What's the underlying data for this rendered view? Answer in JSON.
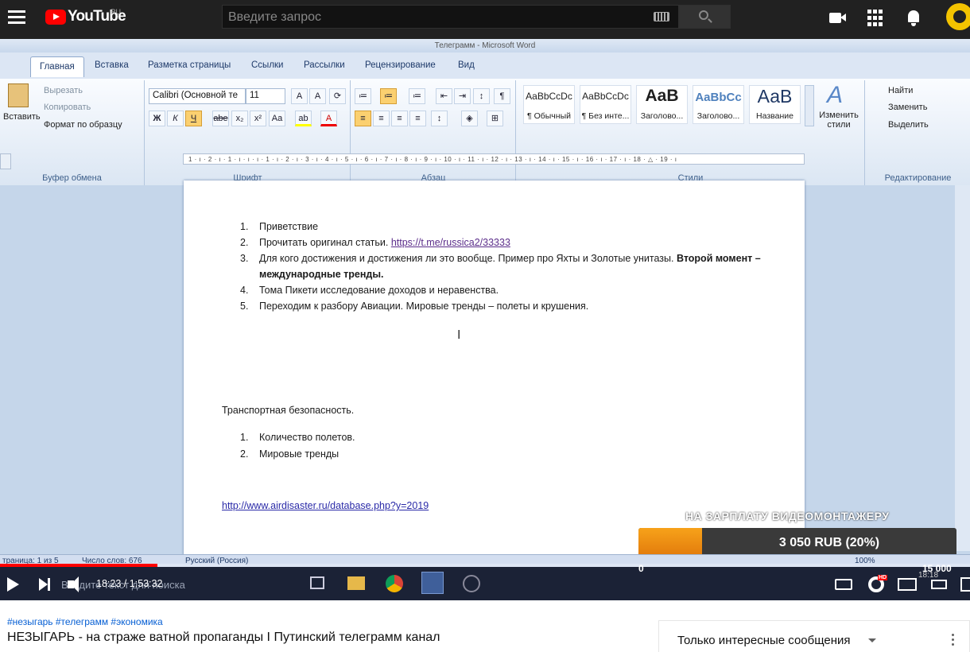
{
  "header": {
    "logo_text": "YouTube",
    "region": "RU",
    "search_placeholder": "Введите запрос"
  },
  "word": {
    "window_title": "Телеграмм - Microsoft Word",
    "tabs": [
      "Главная",
      "Вставка",
      "Разметка страницы",
      "Ссылки",
      "Рассылки",
      "Рецензирование",
      "Вид"
    ],
    "clipboard": {
      "paste": "Вставить",
      "cut": "Вырезать",
      "copy": "Копировать",
      "format_painter": "Формат по образцу",
      "label": "Буфер обмена"
    },
    "font": {
      "name": "Calibri (Основной те",
      "size": "11",
      "label": "Шрифт"
    },
    "paragraph": {
      "label": "Абзац"
    },
    "styles": {
      "tiles": [
        {
          "sample": "AaBbCcDc",
          "name": "¶ Обычный"
        },
        {
          "sample": "AaBbCcDc",
          "name": "¶ Без инте..."
        },
        {
          "sample": "AaB",
          "name": "Заголово..."
        },
        {
          "sample": "AaBbCc",
          "name": "Заголово..."
        },
        {
          "sample": "АаВ",
          "name": "Название"
        }
      ],
      "change": "Изменить стили",
      "label": "Стили"
    },
    "editing": {
      "find": "Найти",
      "replace": "Заменить",
      "select": "Выделить",
      "label": "Редактирование"
    },
    "ruler": "1 · ı · 2 · ı · 1 · ı · ı · ı · 1 · ı · 2 · ı · 3 · ı · 4 · ı · 5 · ı · 6 · ı · 7 · ı · 8 · ı · 9 · ı · 10 · ı · 11 · ı · 12 · ı · 13 · ı · 14 · ı · 15 · ı · 16 · ı · 17 · ı · 18 · △ · 19 · ı",
    "doc": {
      "list1": [
        {
          "num": "1.",
          "text": "Приветствие"
        },
        {
          "num": "2.",
          "text": "Прочитать оригинал статьи. ",
          "link": "https://t.me/russica2/33333"
        },
        {
          "num": "3.",
          "text": "Для кого достижения и достижения ли это вообще. Пример про Яхты и Золотые унитазы. ",
          "bold": "Второй момент – международные тренды."
        },
        {
          "num": "4.",
          "text": "Тома Пикети исследование доходов и неравенства."
        },
        {
          "num": "5.",
          "text": "Переходим к разбору Авиации. Мировые тренды – полеты и крушения."
        }
      ],
      "heading2": "Транспортная безопасность.",
      "list2": [
        {
          "num": "1.",
          "text": "Количество полетов."
        },
        {
          "num": "2.",
          "text": "Мировые тренды"
        }
      ],
      "url": "http://www.airdisaster.ru/database.php?y=2019"
    },
    "status": {
      "page": "траница: 1 из 5",
      "words": "Число слов: 676",
      "lang": "Русский (Россия)",
      "zoom": "100%"
    },
    "taskbar_search": "Введите текст для поиска",
    "clock": "18:18"
  },
  "player": {
    "time": "18:23 / 1:53:32",
    "progress": 0.162,
    "donation": {
      "title": "НА ЗАРПЛАТУ ВИДЕОМОНТАЖЕРУ",
      "amount": "3 050 RUB (20%)",
      "fraction": 0.2,
      "min": "0",
      "max": "15 000"
    }
  },
  "below": {
    "hashtags": "#незыгарь #телеграмм #экономика",
    "title": "НЕЗЫГАРЬ - на страже ватной пропаганды I Путинский телеграмм канал",
    "chat_filter": "Только интересные сообщения"
  },
  "colors": {
    "header_bg": "#212121",
    "progress": "#ff0000",
    "donation_fill": "#f7a21a",
    "link": "#065fd4"
  }
}
